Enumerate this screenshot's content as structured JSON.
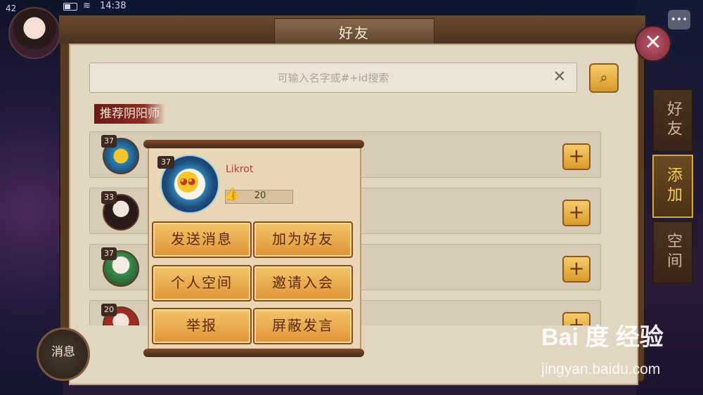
{
  "status": {
    "time": "14:38",
    "level": "42"
  },
  "window": {
    "title": "好友"
  },
  "search": {
    "placeholder": "可输入名字或#+id搜索"
  },
  "section": {
    "title": "推荐阴阳师"
  },
  "list": [
    {
      "level": "37"
    },
    {
      "level": "33"
    },
    {
      "level": "37"
    },
    {
      "level": "20"
    }
  ],
  "tabs": [
    {
      "label": "好友"
    },
    {
      "label": "添加"
    },
    {
      "label": "空间"
    }
  ],
  "bottom": {
    "message_label": "消息"
  },
  "popup": {
    "level": "37",
    "name": "Likrot",
    "likes": "20",
    "actions": [
      "发送消息",
      "加为好友",
      "个人空间",
      "邀请入会",
      "举报",
      "屏蔽发言"
    ]
  },
  "watermark": {
    "logo": "Bai 度 经验",
    "url": "jingyan.baidu.com"
  },
  "colors": {
    "accent": "#e09436",
    "name": "#c43a3a",
    "active_tab": "#f6cf5a"
  }
}
